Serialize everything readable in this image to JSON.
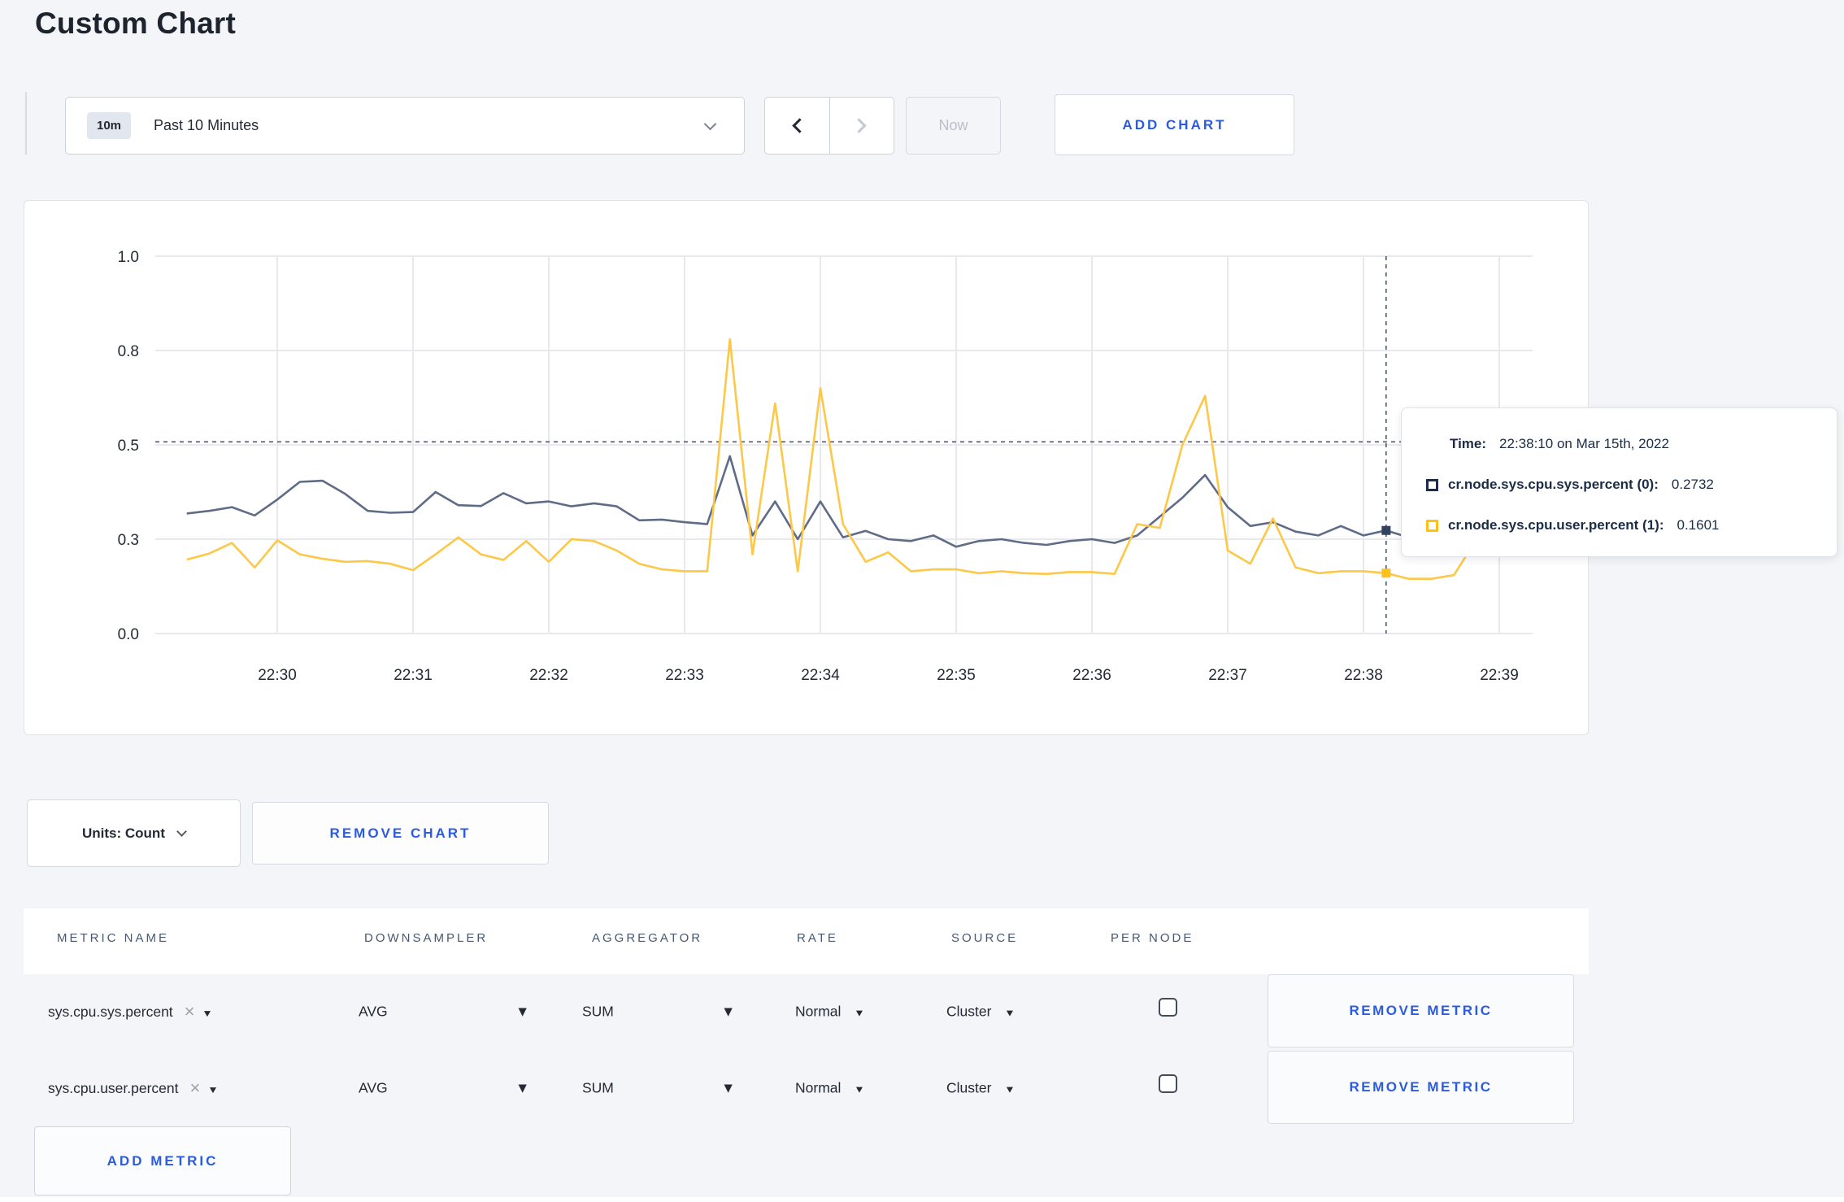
{
  "page": {
    "title": "Custom Chart"
  },
  "toolbar": {
    "range_badge": "10m",
    "range_label": "Past 10 Minutes",
    "now_label": "Now",
    "add_chart_label": "ADD CHART"
  },
  "tooltip": {
    "time_label": "Time:",
    "time_value": "22:38:10 on Mar 15th, 2022",
    "series": [
      {
        "name": "cr.node.sys.cpu.sys.percent (0):",
        "value": "0.2732",
        "swatch": "#1c2c4c"
      },
      {
        "name": "cr.node.sys.cpu.user.percent (1):",
        "value": "0.1601",
        "swatch": "#ffc117"
      }
    ]
  },
  "chart_data": {
    "type": "line",
    "title": "",
    "xlabel": "",
    "ylabel": "",
    "ylim": [
      0,
      1
    ],
    "grid": true,
    "x_ticks": [
      "22:30",
      "22:31",
      "22:32",
      "22:33",
      "22:34",
      "22:35",
      "22:36",
      "22:37",
      "22:38",
      "22:39"
    ],
    "y_tick_labels": [
      "0.0",
      "0.3",
      "0.5",
      "0.8",
      "1.0"
    ],
    "y_tick_values": [
      0,
      0.25,
      0.5,
      0.75,
      1.0
    ],
    "x_start_offset_seconds": -40,
    "x_step_seconds": 10,
    "series": [
      {
        "name": "cr.node.sys.cpu.sys.percent",
        "color": "#5f6c87",
        "values": [
          0.318,
          0.325,
          0.335,
          0.313,
          0.355,
          0.402,
          0.405,
          0.37,
          0.325,
          0.32,
          0.322,
          0.375,
          0.34,
          0.338,
          0.372,
          0.345,
          0.35,
          0.337,
          0.345,
          0.337,
          0.3,
          0.302,
          0.295,
          0.29,
          0.47,
          0.26,
          0.35,
          0.25,
          0.35,
          0.255,
          0.272,
          0.25,
          0.245,
          0.26,
          0.23,
          0.245,
          0.25,
          0.24,
          0.235,
          0.245,
          0.25,
          0.24,
          0.26,
          0.31,
          0.36,
          0.42,
          0.335,
          0.285,
          0.295,
          0.27,
          0.26,
          0.285,
          0.26,
          0.2732,
          0.255,
          0.26,
          0.25,
          0.245,
          0.25,
          0.265
        ]
      },
      {
        "name": "cr.node.sys.cpu.user.percent",
        "color": "#fdc748",
        "values": [
          0.196,
          0.212,
          0.24,
          0.175,
          0.247,
          0.21,
          0.198,
          0.19,
          0.192,
          0.185,
          0.168,
          0.21,
          0.255,
          0.21,
          0.195,
          0.245,
          0.19,
          0.25,
          0.245,
          0.22,
          0.185,
          0.17,
          0.165,
          0.165,
          0.78,
          0.21,
          0.61,
          0.165,
          0.65,
          0.29,
          0.19,
          0.215,
          0.165,
          0.17,
          0.17,
          0.16,
          0.165,
          0.16,
          0.158,
          0.163,
          0.163,
          0.158,
          0.29,
          0.28,
          0.5,
          0.63,
          0.22,
          0.185,
          0.305,
          0.175,
          0.16,
          0.165,
          0.165,
          0.1601,
          0.145,
          0.145,
          0.155,
          0.25,
          0.3,
          0.235
        ]
      }
    ],
    "crosshair": {
      "time": "22:38:10",
      "x_offset_seconds": 490,
      "h_line_value": 0.508,
      "marker_values": [
        0.2732,
        0.1601
      ],
      "marker_colors": [
        "#33435f",
        "#ffc117"
      ]
    }
  },
  "units_bar": {
    "units_label": "Units: Count",
    "remove_chart_label": "REMOVE CHART"
  },
  "metrics_table": {
    "headers": [
      "METRIC NAME",
      "DOWNSAMPLER",
      "AGGREGATOR",
      "RATE",
      "SOURCE",
      "PER NODE"
    ],
    "rows": [
      {
        "metric": "sys.cpu.sys.percent",
        "downsampler": "AVG",
        "aggregator": "SUM",
        "rate": "Normal",
        "source": "Cluster",
        "per_node_checked": false,
        "remove_label": "REMOVE METRIC"
      },
      {
        "metric": "sys.cpu.user.percent",
        "downsampler": "AVG",
        "aggregator": "SUM",
        "rate": "Normal",
        "source": "Cluster",
        "per_node_checked": false,
        "remove_label": "REMOVE METRIC"
      }
    ],
    "add_metric_label": "ADD METRIC"
  }
}
